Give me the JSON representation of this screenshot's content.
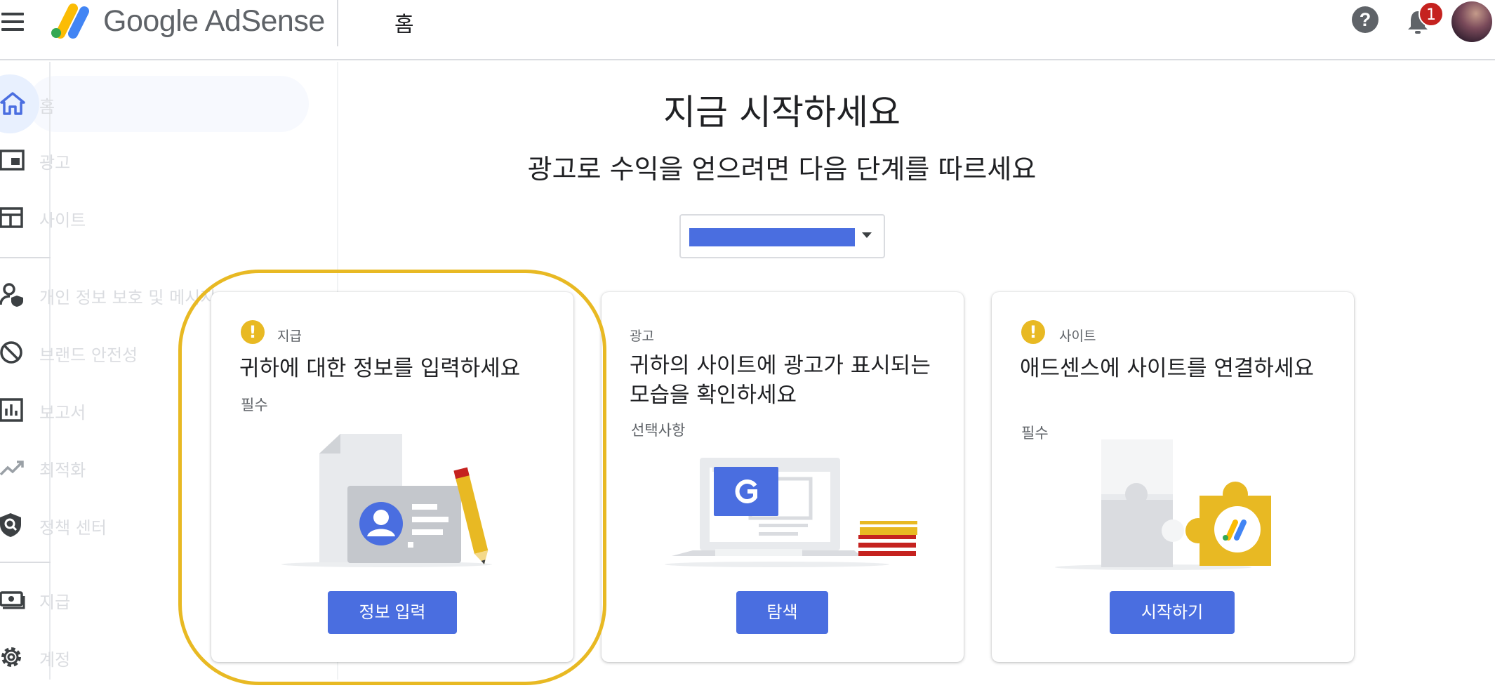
{
  "app": {
    "brand": "Google AdSense",
    "page_title": "홈",
    "notification_count": "1"
  },
  "sidebar": {
    "items": [
      {
        "label": "홈",
        "icon": "home-icon"
      },
      {
        "label": "광고",
        "icon": "ads-icon"
      },
      {
        "label": "사이트",
        "icon": "sites-icon"
      },
      {
        "label": "개인 정보 보호 및 메시지",
        "icon": "privacy-messaging-icon"
      },
      {
        "label": "브랜드 안전성",
        "icon": "block-icon"
      },
      {
        "label": "보고서",
        "icon": "reports-icon"
      },
      {
        "label": "최적화",
        "icon": "optimization-icon"
      },
      {
        "label": "정책 센터",
        "icon": "policy-shield-icon"
      },
      {
        "label": "지급",
        "icon": "payments-icon"
      },
      {
        "label": "계정",
        "icon": "settings-gear-icon"
      }
    ]
  },
  "main": {
    "headline": "지금 시작하세요",
    "subheadline": "광고로 수익을 얻으려면 다음 단계를 따르세요"
  },
  "cards": [
    {
      "category": "지급",
      "title": "귀하에 대한 정보를 입력하세요",
      "status": "필수",
      "button": "정보 입력",
      "warning": "!"
    },
    {
      "category": "광고",
      "title": "귀하의 사이트에 광고가 표시되는 모습을 확인하세요",
      "status": "선택사항",
      "button": "탐색"
    },
    {
      "category": "사이트",
      "title": "애드센스에 사이트를 연결하세요",
      "status": "필수",
      "button": "시작하기",
      "warning": "!"
    }
  ],
  "colors": {
    "accent_blue": "#4a6ee0",
    "warning_yellow": "#e8b923",
    "badge_red": "#c5221f"
  }
}
